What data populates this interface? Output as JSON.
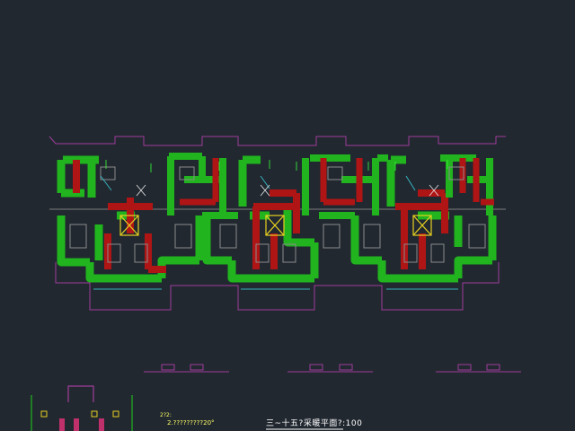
{
  "drawing": {
    "title": "三~十五?采暖平面?:100",
    "note_heading": "2?2:",
    "note_item": "2.?????????20°",
    "units_marked": 3
  },
  "palette": {
    "background": "#212830",
    "wall_green": "#21b41e",
    "wall_red": "#b01515",
    "outline_magenta": "#a03d9a",
    "equipment_yellow": "#e8d020",
    "fixture_gray": "#8c8c8c",
    "pipe_cyan": "#36b3bf",
    "annotation_white": "#e6e6e6",
    "annotation_green": "#39ff39"
  }
}
